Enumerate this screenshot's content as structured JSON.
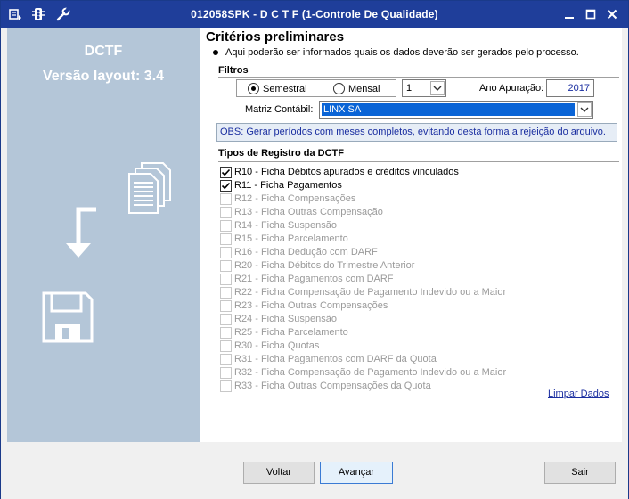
{
  "window": {
    "title": "012058SPK - D C T F (1-Controle De Qualidade)"
  },
  "left_panel": {
    "title": "DCTF",
    "subtitle": "Versão layout: 3.4"
  },
  "main": {
    "heading": "Critérios preliminares",
    "description": "Aqui poderão ser informados quais os dados deverão ser gerados pelo processo.",
    "filters": {
      "label": "Filtros",
      "periodicity": [
        {
          "label": "Semestral",
          "selected": true
        },
        {
          "label": "Mensal",
          "selected": false
        }
      ],
      "period_value": "1",
      "year_label": "Ano Apuração:",
      "year_value": "2017",
      "matrix_label": "Matriz Contábil:",
      "matrix_value": "LINX SA"
    },
    "obs": "OBS: Gerar períodos com meses completos, evitando desta forma a rejeição do arquivo.",
    "records": {
      "label": "Tipos de Registro da DCTF",
      "items": [
        {
          "label": "R10 - Ficha Débitos apurados e créditos vinculados",
          "checked": true,
          "enabled": true
        },
        {
          "label": "R11 - Ficha Pagamentos",
          "checked": true,
          "enabled": true
        },
        {
          "label": "R12 - Ficha Compensações",
          "checked": false,
          "enabled": false
        },
        {
          "label": "R13 - Ficha Outras Compensação",
          "checked": false,
          "enabled": false
        },
        {
          "label": "R14 - Ficha Suspensão",
          "checked": false,
          "enabled": false
        },
        {
          "label": "R15 - Ficha Parcelamento",
          "checked": false,
          "enabled": false
        },
        {
          "label": "R16 - Ficha Dedução com DARF",
          "checked": false,
          "enabled": false
        },
        {
          "label": "R20 - Ficha Débitos do Trimestre Anterior",
          "checked": false,
          "enabled": false
        },
        {
          "label": "R21 - Ficha Pagamentos com DARF",
          "checked": false,
          "enabled": false
        },
        {
          "label": "R22 - Ficha Compensação de Pagamento Indevido ou a Maior",
          "checked": false,
          "enabled": false
        },
        {
          "label": "R23 - Ficha Outras Compensações",
          "checked": false,
          "enabled": false
        },
        {
          "label": "R24 - Ficha Suspensão",
          "checked": false,
          "enabled": false
        },
        {
          "label": "R25 - Ficha Parcelamento",
          "checked": false,
          "enabled": false
        },
        {
          "label": "R30 - Ficha Quotas",
          "checked": false,
          "enabled": false
        },
        {
          "label": "R31 - Ficha Pagamentos com DARF da Quota",
          "checked": false,
          "enabled": false
        },
        {
          "label": "R32 - Ficha Compensação de Pagamento Indevido ou a Maior",
          "checked": false,
          "enabled": false
        },
        {
          "label": "R33 - Ficha Outras Compensações da Quota",
          "checked": false,
          "enabled": false
        }
      ],
      "clear_link": "Limpar Dados"
    }
  },
  "buttons": {
    "back": "Voltar",
    "next": "Avançar",
    "exit": "Sair"
  },
  "colors": {
    "titlebar": "#1f3e9a",
    "left_panel": "#b4c6d8",
    "matrix_highlight": "#0a64d6"
  }
}
